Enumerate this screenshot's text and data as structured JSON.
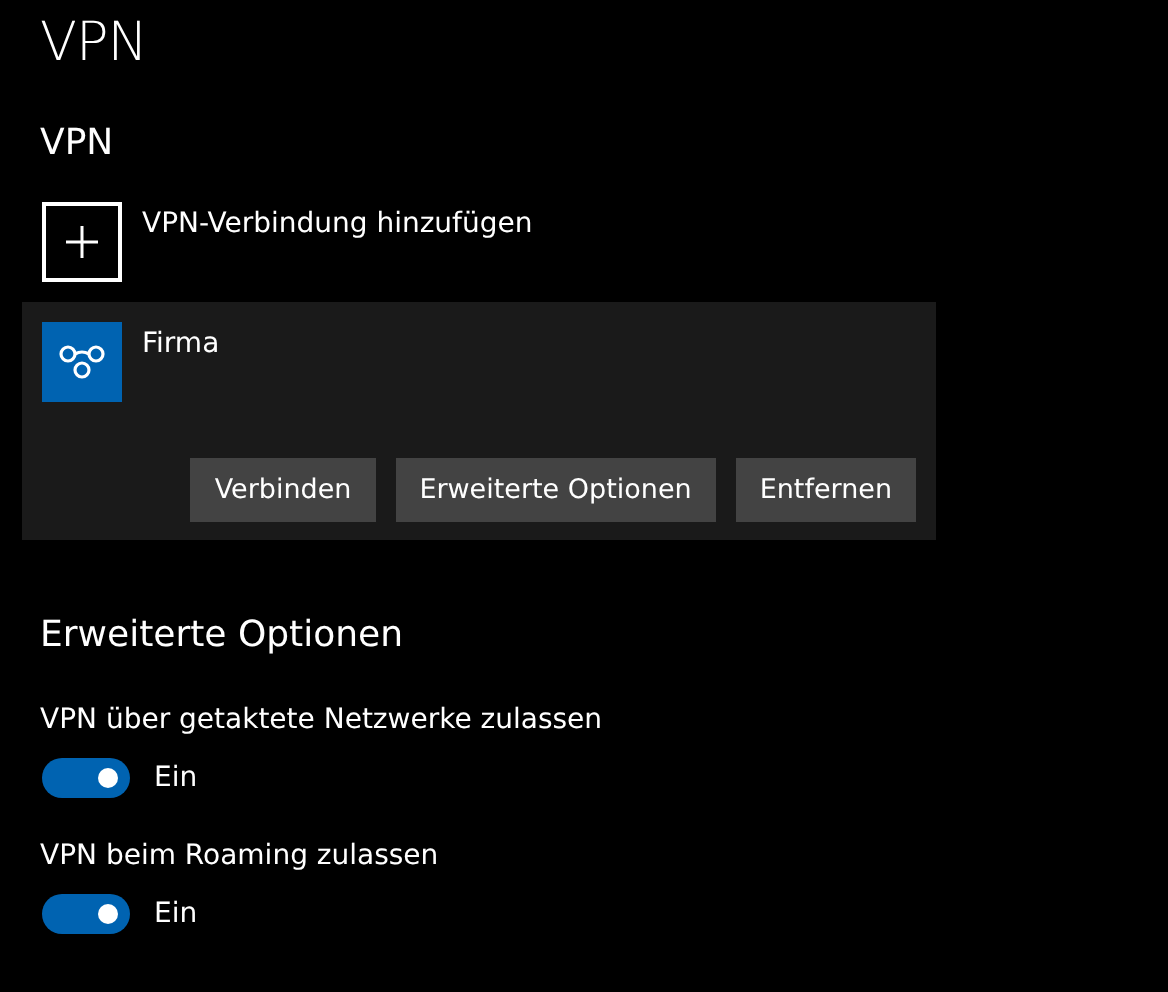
{
  "page_title": "VPN",
  "vpn_section": {
    "heading": "VPN",
    "add_label": "VPN-Verbindung hinzufügen",
    "connections": [
      {
        "name": "Firma",
        "selected": true,
        "buttons": [
          "Verbinden",
          "Erweiterte Optionen",
          "Entfernen"
        ]
      }
    ]
  },
  "advanced": {
    "heading": "Erweiterte Optionen",
    "toggles": [
      {
        "label": "VPN über getaktete Netzwerke zulassen",
        "on": true,
        "state_text": "Ein"
      },
      {
        "label": "VPN beim Roaming zulassen",
        "on": true,
        "state_text": "Ein"
      }
    ]
  }
}
